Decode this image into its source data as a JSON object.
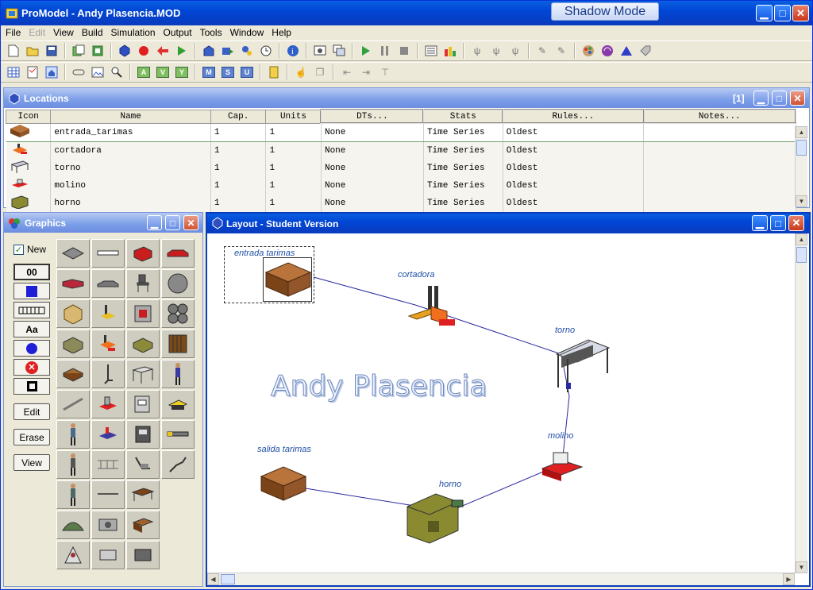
{
  "window": {
    "title": "ProModel - Andy Plasencia.MOD",
    "shadow_mode": "Shadow Mode"
  },
  "menu": [
    "File",
    "Edit",
    "View",
    "Build",
    "Simulation",
    "Output",
    "Tools",
    "Window",
    "Help"
  ],
  "toolbar_letters": [
    "A",
    "V",
    "Y",
    "M",
    "S",
    "U"
  ],
  "locations": {
    "title": "Locations",
    "window_count": "[1]",
    "columns": [
      "Icon",
      "Name",
      "Cap.",
      "Units",
      "DTs...",
      "Stats",
      "Rules...",
      "Notes..."
    ],
    "rows": [
      {
        "name": "entrada_tarimas",
        "cap": "1",
        "units": "1",
        "dts": "None",
        "stats": "Time Series",
        "rules": "Oldest"
      },
      {
        "name": "cortadora",
        "cap": "1",
        "units": "1",
        "dts": "None",
        "stats": "Time Series",
        "rules": "Oldest"
      },
      {
        "name": "torno",
        "cap": "1",
        "units": "1",
        "dts": "None",
        "stats": "Time Series",
        "rules": "Oldest"
      },
      {
        "name": "molino",
        "cap": "1",
        "units": "1",
        "dts": "None",
        "stats": "Time Series",
        "rules": "Oldest"
      },
      {
        "name": "horno",
        "cap": "1",
        "units": "1",
        "dts": "None",
        "stats": "Time Series",
        "rules": "Oldest"
      }
    ]
  },
  "graphics": {
    "title": "Graphics",
    "new_label": "New",
    "new_checked": true,
    "tool_00": "00",
    "tool_aa": "Aa",
    "edit_label": "Edit",
    "erase_label": "Erase",
    "view_label": "View"
  },
  "layout": {
    "title": "Layout - Student Version",
    "watermark": "Andy Plasencia",
    "labels": {
      "entrada": "entrada tarimas",
      "cortadora": "cortadora",
      "torno": "torno",
      "molino": "molino",
      "horno": "horno",
      "salida": "salida tarimas"
    }
  },
  "colors": {
    "title_blue": "#0046d5",
    "label_blue": "#1f4fa8",
    "path_line": "#2a2aa0"
  }
}
